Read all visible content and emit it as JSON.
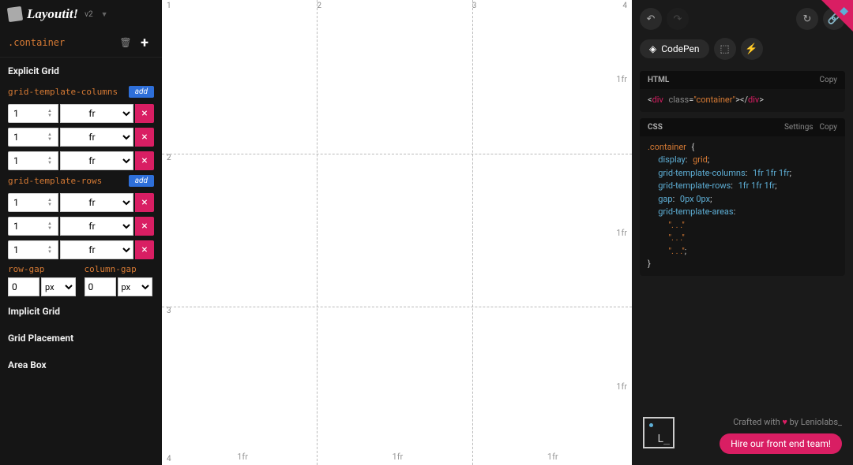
{
  "logo": {
    "name": "Layoutit!",
    "version": "v2"
  },
  "container": ".container",
  "sections": {
    "explicit": "Explicit Grid",
    "implicit": "Implicit Grid",
    "placement": "Grid Placement",
    "areabox": "Area Box"
  },
  "props": {
    "cols": "grid-template-columns",
    "rows": "grid-template-rows",
    "rowgap": "row-gap",
    "colgap": "column-gap",
    "add": "add"
  },
  "cols": [
    {
      "v": "1",
      "u": "fr"
    },
    {
      "v": "1",
      "u": "fr"
    },
    {
      "v": "1",
      "u": "fr"
    }
  ],
  "rows": [
    {
      "v": "1",
      "u": "fr"
    },
    {
      "v": "1",
      "u": "fr"
    },
    {
      "v": "1",
      "u": "fr"
    }
  ],
  "gap": {
    "row": {
      "v": "0",
      "u": "px"
    },
    "col": {
      "v": "0",
      "u": "px"
    }
  },
  "grid": {
    "nums": [
      "1",
      "2",
      "3",
      "4"
    ],
    "fr": "1fr",
    "col_fr": [
      "1fr",
      "1fr",
      "1fr"
    ],
    "row_fr": [
      "1fr",
      "1fr",
      "1fr"
    ]
  },
  "toolbar": {
    "undo": "↶",
    "redo": "↷",
    "reset": "↻",
    "share": "🔗"
  },
  "export": {
    "codepen": "CodePen",
    "codesandbox": "⬚",
    "stackblitz": "⚡"
  },
  "panels": {
    "html": {
      "lang": "HTML",
      "copy": "Copy"
    },
    "css": {
      "lang": "CSS",
      "settings": "Settings",
      "copy": "Copy"
    }
  },
  "code": {
    "html_raw": "<div class=\"container\"></div>",
    "css": {
      "selector": ".container",
      "display": "grid",
      "cols": "1fr 1fr 1fr",
      "rows": "1fr 1fr 1fr",
      "gap": "0px 0px",
      "areas": [
        "\". . .\"",
        "\". . .\"",
        "\". . .\""
      ]
    }
  },
  "footer": {
    "credit_pre": "Crafted with ",
    "credit_heart": "♥",
    "credit_post": " by Leniolabs_",
    "hire": "Hire our front end team!"
  }
}
